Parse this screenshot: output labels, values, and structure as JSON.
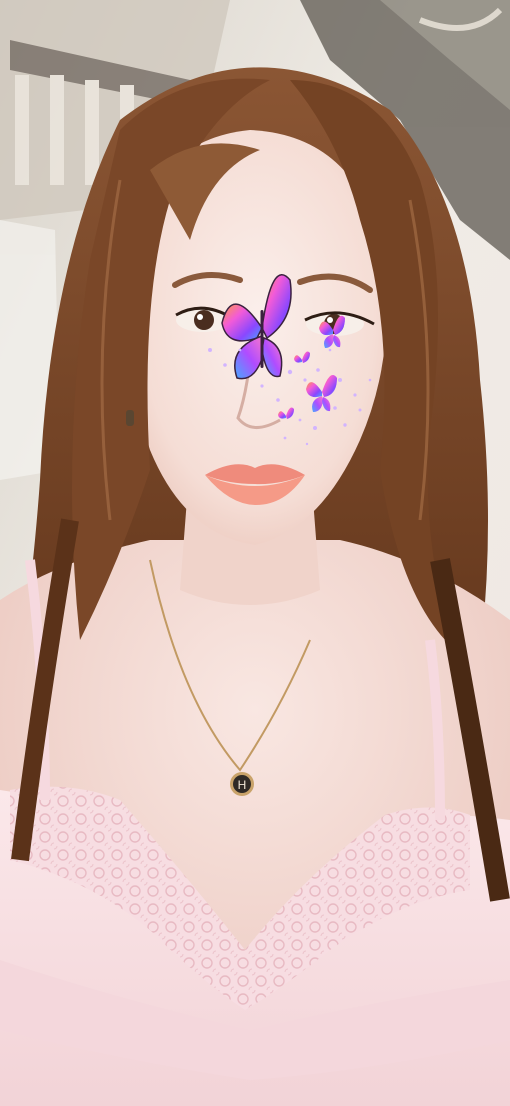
{
  "photo": {
    "type": "selfie-with-filter",
    "filter": {
      "name": "butterfly-sparkle-face-filter",
      "elements": [
        "large-butterfly",
        "small-butterflies",
        "glitter-sparkles"
      ],
      "colors": {
        "butterfly_orange": "#ff9d3d",
        "butterfly_pink": "#f25bd8",
        "butterfly_purple": "#8a47ff",
        "butterfly_blue": "#46a9ff",
        "sparkle_lilac": "#d2b4ff"
      }
    },
    "palette": {
      "hair": "#6a3f22",
      "hair_highlight": "#9a6640",
      "skin": "#f5dfd8",
      "lips": "#ef8b7c",
      "camisole_pink": "#f7dde0",
      "lace": "#f1c9cf",
      "background_wall": "#e6dfd7",
      "background_dark": "#524d46"
    }
  }
}
